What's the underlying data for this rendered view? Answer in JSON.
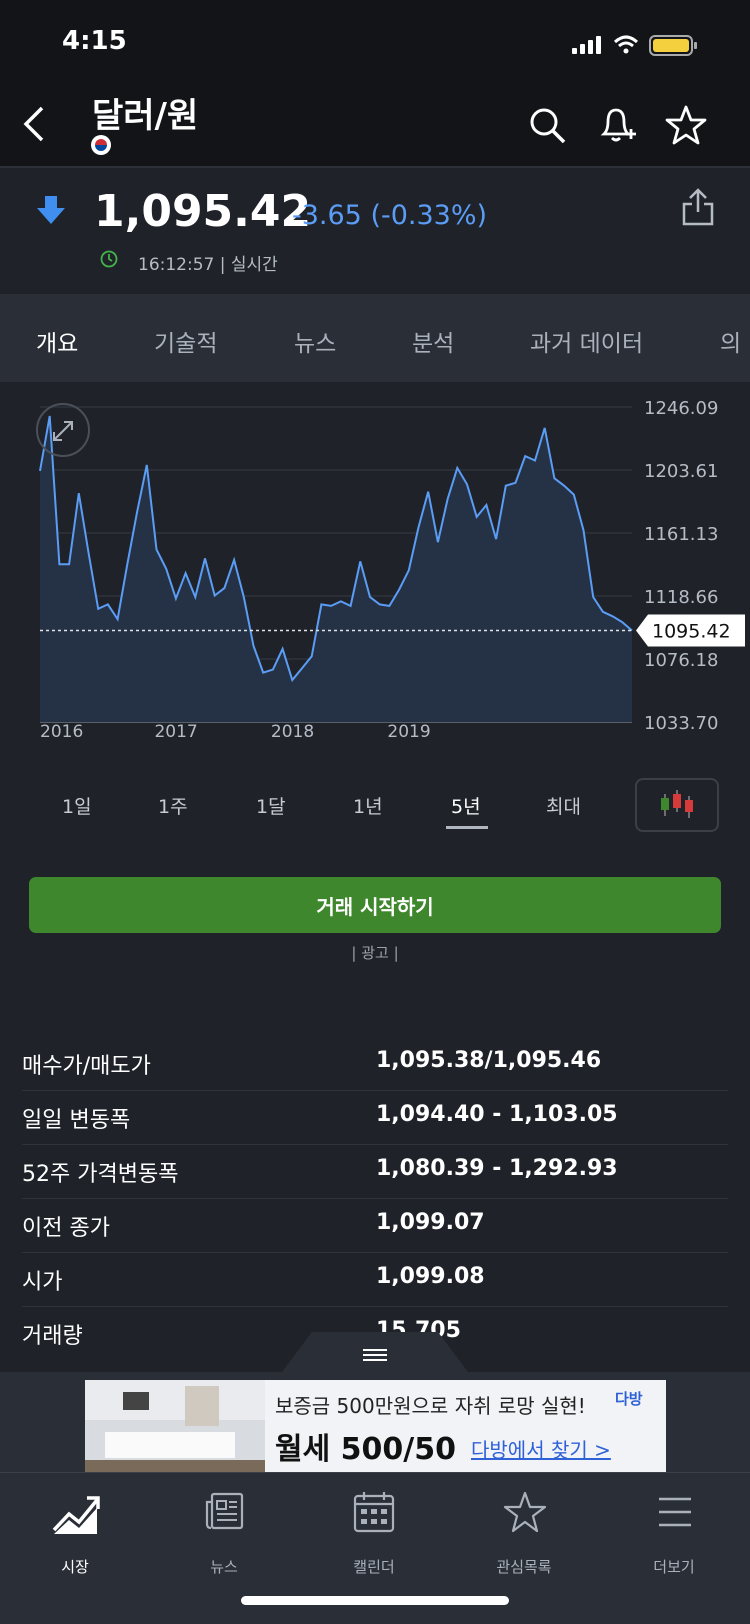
{
  "status_bar": {
    "time": "4:15"
  },
  "header": {
    "title": "달러/원"
  },
  "quote": {
    "price": "1,095.42",
    "change": "-3.65 (-0.33%)",
    "time": "16:12:57 | 실시간"
  },
  "tabs": [
    {
      "label": "개요",
      "active": true
    },
    {
      "label": "기술적"
    },
    {
      "label": "뉴스"
    },
    {
      "label": "분석"
    },
    {
      "label": "과거 데이터"
    },
    {
      "label": "의"
    }
  ],
  "chart_data": {
    "type": "area",
    "x": [
      "2016-01",
      "2016-02",
      "2016-03",
      "2016-04",
      "2016-05",
      "2016-06",
      "2016-07",
      "2016-08",
      "2016-09",
      "2016-10",
      "2016-11",
      "2016-12",
      "2017-01",
      "2017-02",
      "2017-03",
      "2017-04",
      "2017-05",
      "2017-06",
      "2017-07",
      "2017-08",
      "2017-09",
      "2017-10",
      "2017-11",
      "2017-12",
      "2018-01",
      "2018-02",
      "2018-03",
      "2018-04",
      "2018-05",
      "2018-06",
      "2018-07",
      "2018-08",
      "2018-09",
      "2018-10",
      "2018-11",
      "2018-12",
      "2019-01",
      "2019-02",
      "2019-03",
      "2019-04",
      "2019-05",
      "2019-06",
      "2019-07",
      "2019-08",
      "2019-09",
      "2019-10",
      "2019-11",
      "2019-12"
    ],
    "values": [
      1203,
      1240,
      1140,
      1140,
      1188,
      1148,
      1110,
      1113,
      1103,
      1140,
      1175,
      1207,
      1150,
      1137,
      1117,
      1134,
      1118,
      1144,
      1119,
      1124,
      1143,
      1118,
      1085,
      1067,
      1069,
      1083,
      1062,
      1070,
      1078,
      1113,
      1112,
      1115,
      1112,
      1142,
      1118,
      1113,
      1112,
      1123,
      1136,
      1165,
      1189,
      1155,
      1184,
      1205,
      1194,
      1172,
      1180,
      1157,
      1193,
      1195,
      1213,
      1210,
      1232,
      1198,
      1193,
      1187,
      1163,
      1118,
      1108,
      1105,
      1101,
      1095.42
    ],
    "y_ticks": [
      "1246.09",
      "1203.61",
      "1161.13",
      "1118.66",
      "1076.18",
      "1033.70"
    ],
    "x_ticks": [
      "2016",
      "2017",
      "2018",
      "2019"
    ],
    "ylim": [
      1033.7,
      1246.09
    ],
    "last_value_label": "1095.42",
    "grid": true
  },
  "ranges": [
    {
      "label": "1일"
    },
    {
      "label": "1주"
    },
    {
      "label": "1달"
    },
    {
      "label": "1년"
    },
    {
      "label": "5년",
      "active": true
    },
    {
      "label": "최대"
    }
  ],
  "cta": {
    "label": "거래 시작하기"
  },
  "ad_label": "| 광고 |",
  "stats": [
    {
      "label": "매수가/매도가",
      "value": "1,095.38/1,095.46"
    },
    {
      "label": "일일 변동폭",
      "value": "1,094.40 - 1,103.05"
    },
    {
      "label": "52주 가격변동폭",
      "value": "1,080.39 - 1,292.93"
    },
    {
      "label": "이전 종가",
      "value": "1,099.07"
    },
    {
      "label": "시가",
      "value": "1,099.08"
    },
    {
      "label": "거래량",
      "value": "15,705"
    }
  ],
  "banner": {
    "line1": "보증금 500만원으로 자취 로망 실현!",
    "line2": "월세 500/50",
    "link": "다방에서 찾기 >",
    "brand": "다방"
  },
  "tabbar": [
    {
      "label": "시장",
      "icon": "chart-up-icon",
      "active": true
    },
    {
      "label": "뉴스",
      "icon": "news-icon"
    },
    {
      "label": "캘린더",
      "icon": "calendar-icon"
    },
    {
      "label": "관심목록",
      "icon": "star-icon"
    },
    {
      "label": "더보기",
      "icon": "menu-icon"
    }
  ],
  "colors": {
    "accent_blue": "#5b9cf5",
    "cta_green": "#3f872d",
    "background": "#1f2329"
  }
}
